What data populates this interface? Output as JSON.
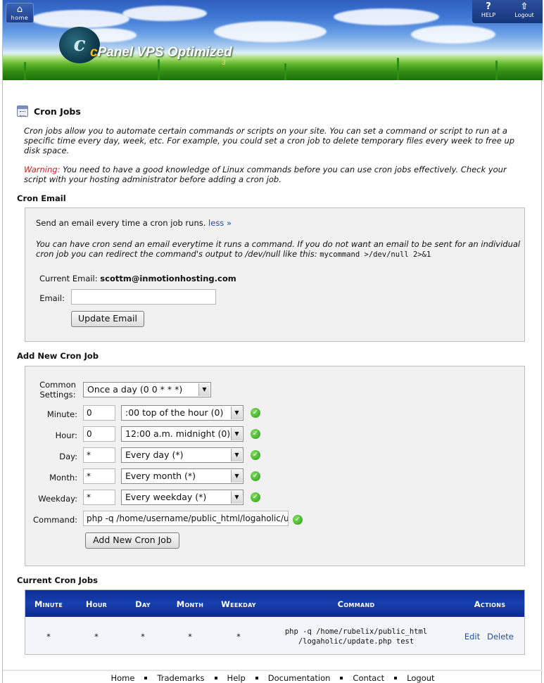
{
  "header": {
    "home_label": "home",
    "help_label": "HELP",
    "logout_label": "Logout",
    "logo_c": "c",
    "logo_text": "Panel VPS Optimized",
    "logo_sub": "3"
  },
  "page": {
    "title": "Cron Jobs",
    "intro": "Cron jobs allow you to automate certain commands or scripts on your site. You can set a command or script to run at a specific time every day, week, etc. For example, you could set a cron job to delete temporary files every week to free up disk space.",
    "warning_label": "Warning:",
    "warning_text": " You need to have a good knowledge of Linux commands before you can use cron jobs effectively. Check your script with your hosting administrator before adding a cron job."
  },
  "cron_email": {
    "heading": "Cron Email",
    "summary": "Send an email every time a cron job runs. ",
    "less_link": "less »",
    "note": "You can have cron send an email everytime it runs a command. If you do not want an email to be sent for an individual cron job you can redirect the command's output to /dev/null like this: ",
    "note_code": "mycommand >/dev/null 2>&1",
    "current_label": "Current Email: ",
    "current_value": "scottm@inmotionhosting.com",
    "email_label": "Email:",
    "email_value": "",
    "update_button": "Update Email"
  },
  "add_job": {
    "heading": "Add New Cron Job",
    "common_label": "Common Settings:",
    "common_value": "Once a day (0 0 * * *)",
    "minute_label": "Minute:",
    "minute_value": "0",
    "minute_select": ":00 top of the hour (0)",
    "hour_label": "Hour:",
    "hour_value": "0",
    "hour_select": "12:00 a.m. midnight (0)",
    "day_label": "Day:",
    "day_value": "*",
    "day_select": "Every day (*)",
    "month_label": "Month:",
    "month_value": "*",
    "month_select": "Every month (*)",
    "weekday_label": "Weekday:",
    "weekday_value": "*",
    "weekday_select": "Every weekday (*)",
    "command_label": "Command:",
    "command_value": "php -q /home/username/public_html/logaholic/up",
    "add_button": "Add New Cron Job"
  },
  "current_jobs": {
    "heading": "Current Cron Jobs",
    "columns": [
      "Minute",
      "Hour",
      "Day",
      "Month",
      "Weekday",
      "Command",
      "Actions"
    ],
    "rows": [
      {
        "minute": "*",
        "hour": "*",
        "day": "*",
        "month": "*",
        "weekday": "*",
        "command_line1": "php -q /home/rubelix/public_html",
        "command_line2": "/logaholic/update.php test",
        "edit": "Edit",
        "delete": "Delete"
      }
    ]
  },
  "footer": {
    "links": [
      "Home",
      "Trademarks",
      "Help",
      "Documentation",
      "Contact",
      "Logout"
    ]
  },
  "colors": {
    "table_header": "#163fae",
    "warning": "#d21a1a",
    "link": "#1c4ea3",
    "ok_icon": "#2a9a18"
  }
}
